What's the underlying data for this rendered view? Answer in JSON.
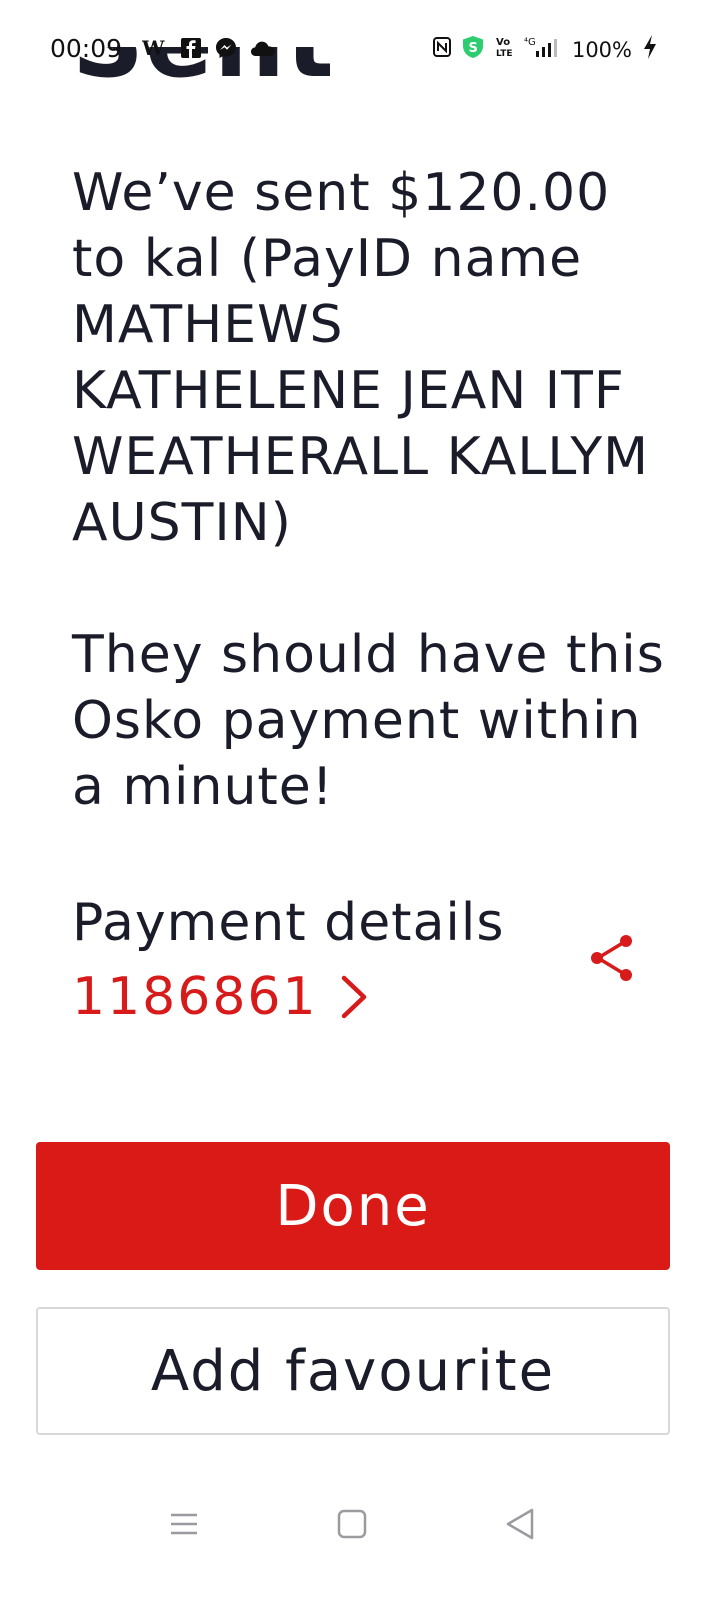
{
  "status_bar": {
    "time": "00:09",
    "left_icons": [
      "wikipedia-icon",
      "facebook-icon",
      "messenger-icon",
      "cloud-icon"
    ],
    "right_icons": [
      "nfc-icon",
      "shield-s-icon",
      "volte-icon",
      "signal-4g-icon"
    ],
    "battery": "100%"
  },
  "header": {
    "partial_title": "Sent"
  },
  "message": {
    "line1": "We’ve sent $120.00 to kal (PayID name MATHEWS KATHELENE JEAN ITF WEATHERALL KALLYM AUSTIN)",
    "line2": "They should have this Osko payment within a minute!"
  },
  "payment_details": {
    "title": "Payment details",
    "reference": "1186861"
  },
  "buttons": {
    "done": "Done",
    "add_favourite": "Add favourite"
  },
  "colors": {
    "accent": "#da1a16",
    "text": "#1b1c2a",
    "border": "#d8d8dc"
  },
  "nav": {
    "items": [
      "menu-icon",
      "home-icon",
      "back-icon"
    ]
  }
}
